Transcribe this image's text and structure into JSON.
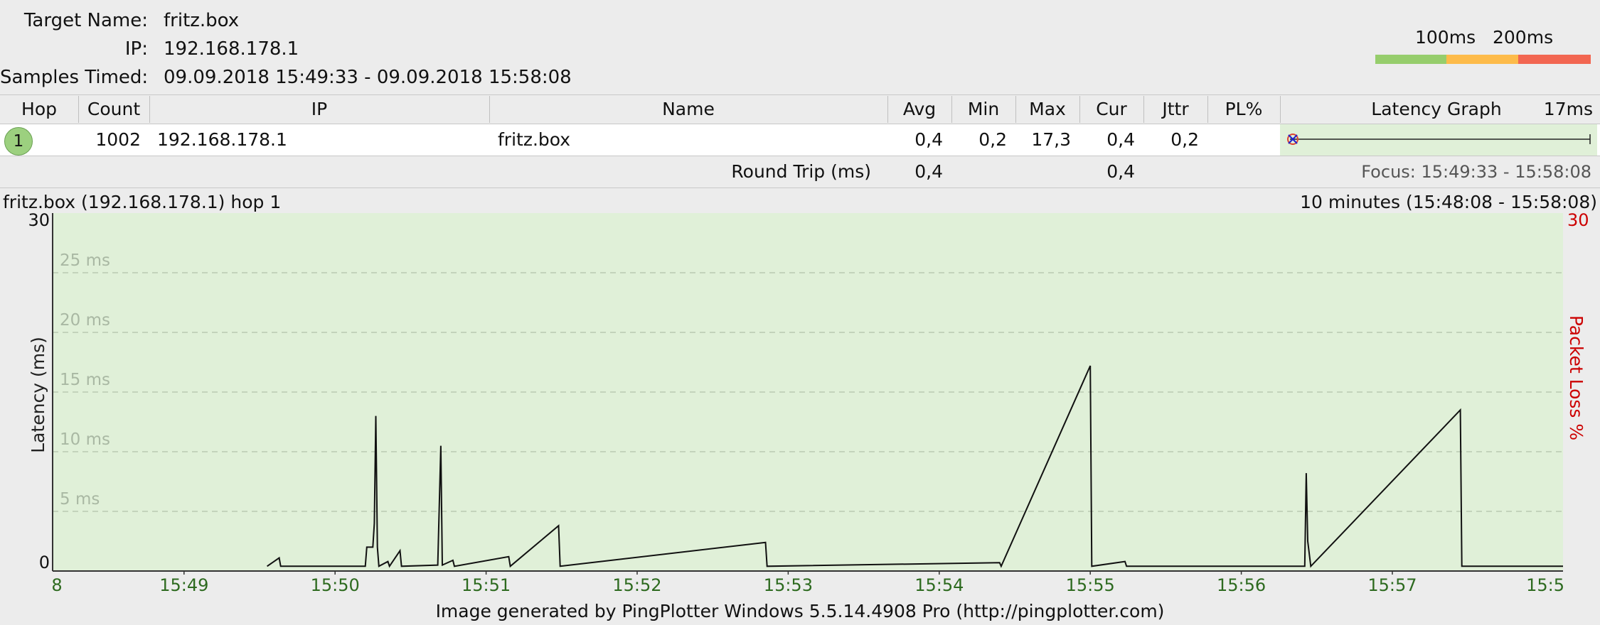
{
  "header": {
    "target_label": "Target Name:",
    "target_value": "fritz.box",
    "ip_label": "IP:",
    "ip_value": "192.168.178.1",
    "samples_label": "Samples Timed:",
    "samples_value": "09.09.2018 15:49:33 - 09.09.2018 15:58:08"
  },
  "legend": {
    "label_100": "100ms",
    "label_200": "200ms",
    "colors": {
      "good": "#96cd6c",
      "warn": "#fdbb4a",
      "bad": "#f26651"
    }
  },
  "table": {
    "columns": [
      "Hop",
      "Count",
      "IP",
      "Name",
      "Avg",
      "Min",
      "Max",
      "Cur",
      "Jttr",
      "PL%",
      "Latency Graph"
    ],
    "graph_scale": "17ms",
    "rows": [
      {
        "hop": "1",
        "count": "1002",
        "ip": "192.168.178.1",
        "name": "fritz.box",
        "avg": "0,4",
        "min": "0,2",
        "max": "17,3",
        "cur": "0,4",
        "jttr": "0,2",
        "pl": ""
      }
    ],
    "round_trip": {
      "label": "Round Trip (ms)",
      "avg": "0,4",
      "cur": "0,4"
    },
    "focus": "Focus: 15:49:33 - 15:58:08"
  },
  "chart_data": {
    "type": "line",
    "title": "fritz.box (192.168.178.1) hop 1",
    "range_label": "10 minutes (15:48:08 - 15:58:08)",
    "ylabel": "Latency (ms)",
    "y2label": "Packet Loss %",
    "ylim": [
      0,
      30
    ],
    "y2lim": [
      0,
      30
    ],
    "y_tick_top": "30",
    "y_tick_bottom": "0",
    "y2_tick_top": "30",
    "y_grid_labels": [
      "25 ms",
      "20 ms",
      "15 ms",
      "10 ms",
      "5 ms"
    ],
    "x_tick_labels": [
      "8",
      "15:49",
      "15:50",
      "15:51",
      "15:52",
      "15:53",
      "15:54",
      "15:55",
      "15:56",
      "15:57",
      "15:5"
    ],
    "xlim_minutes": [
      48.13,
      58.13
    ],
    "series": [
      {
        "values": [
          [
            49.55,
            0.4
          ],
          [
            49.63,
            1.1
          ],
          [
            49.64,
            0.4
          ],
          [
            50.2,
            0.4
          ],
          [
            50.21,
            2.0
          ],
          [
            50.25,
            2.0
          ],
          [
            50.26,
            4.0
          ],
          [
            50.27,
            13.0
          ],
          [
            50.28,
            2.0
          ],
          [
            50.29,
            0.4
          ],
          [
            50.35,
            0.8
          ],
          [
            50.36,
            0.4
          ],
          [
            50.43,
            1.7
          ],
          [
            50.44,
            0.4
          ],
          [
            50.68,
            0.5
          ],
          [
            50.7,
            10.5
          ],
          [
            50.71,
            0.5
          ],
          [
            50.78,
            0.9
          ],
          [
            50.79,
            0.4
          ],
          [
            51.15,
            1.2
          ],
          [
            51.16,
            0.4
          ],
          [
            51.48,
            3.8
          ],
          [
            51.49,
            0.4
          ],
          [
            52.85,
            2.4
          ],
          [
            52.86,
            0.4
          ],
          [
            54.4,
            0.7
          ],
          [
            54.41,
            0.4
          ],
          [
            55.0,
            17.2
          ],
          [
            55.01,
            0.4
          ],
          [
            55.23,
            0.8
          ],
          [
            55.24,
            0.4
          ],
          [
            56.42,
            0.4
          ],
          [
            56.43,
            8.2
          ],
          [
            56.44,
            2.5
          ],
          [
            56.46,
            0.4
          ],
          [
            57.45,
            13.5
          ],
          [
            57.46,
            0.4
          ],
          [
            58.13,
            0.4
          ]
        ]
      }
    ],
    "grid": true,
    "background": "#e0f0d8"
  },
  "footer": {
    "text": "Image generated by PingPlotter Windows 5.5.14.4908 Pro (http://pingplotter.com)"
  }
}
